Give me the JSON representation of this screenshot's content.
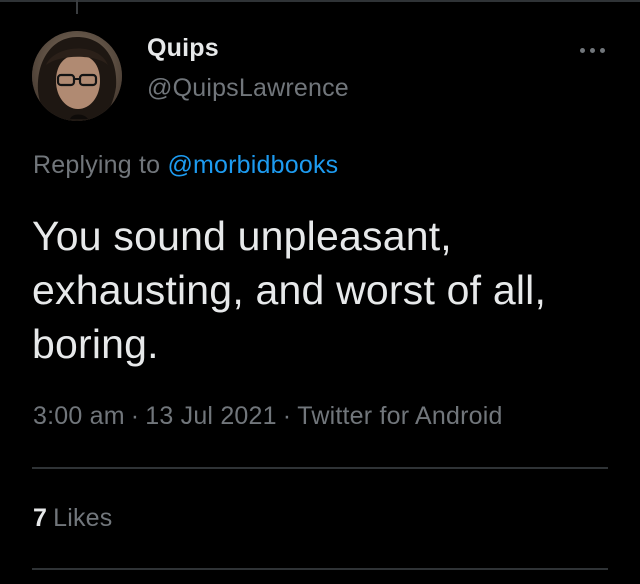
{
  "tweet": {
    "author": {
      "display_name": "Quips",
      "handle": "@QuipsLawrence"
    },
    "more_icon": "more-horizontal-icon",
    "reply_context": {
      "prefix": "Replying to",
      "mention": "@morbidbooks"
    },
    "text_lines": [
      "You sound unpleasant,",
      "exhausting, and worst of all,",
      "boring."
    ],
    "meta": {
      "time": "3:00 am",
      "separator": "·",
      "date": "13 Jul 2021",
      "source": "Twitter for Android"
    },
    "stats": {
      "likes_count": "7",
      "likes_label": "Likes"
    }
  },
  "colors": {
    "background": "#000000",
    "primary_text": "#e7e9ea",
    "secondary_text": "#71767b",
    "link": "#1d9bf0",
    "divider": "#2f3336"
  }
}
